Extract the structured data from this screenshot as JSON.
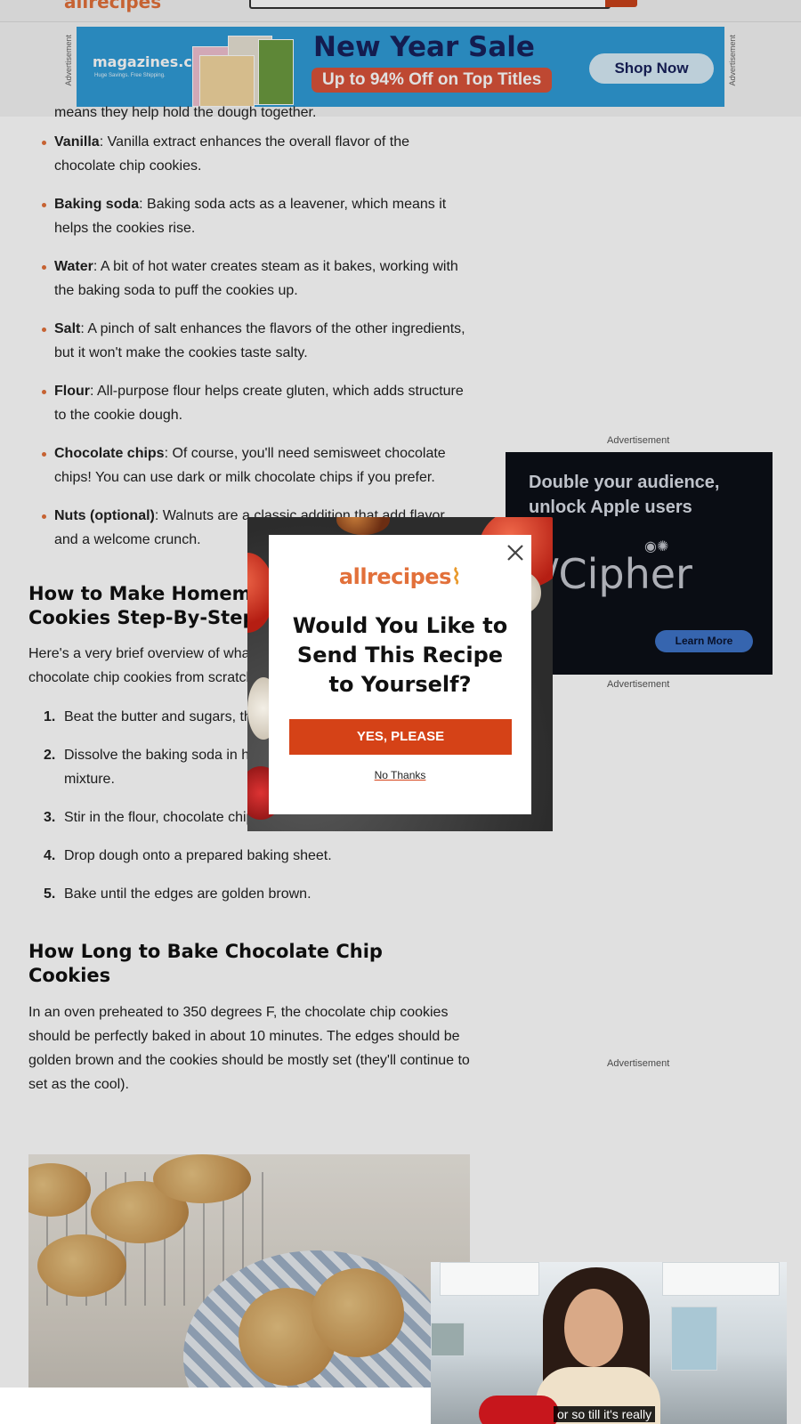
{
  "header": {
    "logo_text": "allrecipes"
  },
  "top_ad": {
    "label": "Advertisement",
    "brand": "magazines.com",
    "brand_tagline": "Huge Savings. Free Shipping.",
    "headline": "New Year Sale",
    "subheadline": "Up to 94% Off on Top Titles",
    "cta": "Shop Now"
  },
  "article": {
    "ingredients_partial_line": "means they help hold the dough together.",
    "ingredients": [
      {
        "name": "Vanilla",
        "text": ": Vanilla extract enhances the overall flavor of the chocolate chip cookies."
      },
      {
        "name": "Baking soda",
        "text": ": Baking soda acts as a leavener, which means it helps the cookies rise."
      },
      {
        "name": "Water",
        "text": ": A bit of hot water creates steam as it bakes, working with the baking soda to puff the cookies up."
      },
      {
        "name": "Salt",
        "text": ": A pinch of salt enhances the flavors of the other ingredients, but it won't make the cookies taste salty."
      },
      {
        "name": "Flour",
        "text": ": All-purpose flour helps create gluten, which adds structure to the cookie dough."
      },
      {
        "name": "Chocolate chips",
        "text": ": Of course, you'll need semisweet chocolate chips! You can use dark or milk chocolate chips if you prefer."
      },
      {
        "name": "Nuts (optional)",
        "text": ": Walnuts are a classic addition that add flavor and a welcome crunch."
      }
    ],
    "section1_title": "How to Make Homemade Chocolate Chip Cookies Step-By-Step",
    "section1_intro": "Here's a very brief overview of what you can expect when you make chocolate chip cookies from scratch:",
    "steps": [
      {
        "num": "1.",
        "text": "Beat the butter and sugars, then add the eggs and vanilla."
      },
      {
        "num": "2.",
        "text": "Dissolve the baking soda in hot water and add it to the batter mixture."
      },
      {
        "num": "3.",
        "text": "Stir in the flour, chocolate chips, and walnuts."
      },
      {
        "num": "4.",
        "text": "Drop dough onto a prepared baking sheet."
      },
      {
        "num": "5.",
        "text": "Bake until the edges are golden brown."
      }
    ],
    "section2_title": "How Long to Bake Chocolate Chip Cookies",
    "section2_body": "In an oven preheated to 350 degrees F, the chocolate chip cookies should be perfectly baked in about 10 minutes. The edges should be golden brown and the cookies should be mostly set (they'll continue to set as the cool)."
  },
  "side_ads": {
    "label": "Advertisement",
    "cipher_headline": "Double your audience, unlock Apple users",
    "cipher_logo": "/Cipher",
    "cipher_cta": "Learn More"
  },
  "modal": {
    "logo_text": "allrecipes",
    "title": "Would You Like to Send This Recipe to Yourself?",
    "yes_label": "YES, PLEASE",
    "no_label": "No Thanks"
  },
  "video": {
    "caption": "or so till it's really"
  },
  "colors": {
    "brand_orange": "#e2703a",
    "button_red": "#d54217",
    "ad_blue": "#2f9bd6"
  }
}
